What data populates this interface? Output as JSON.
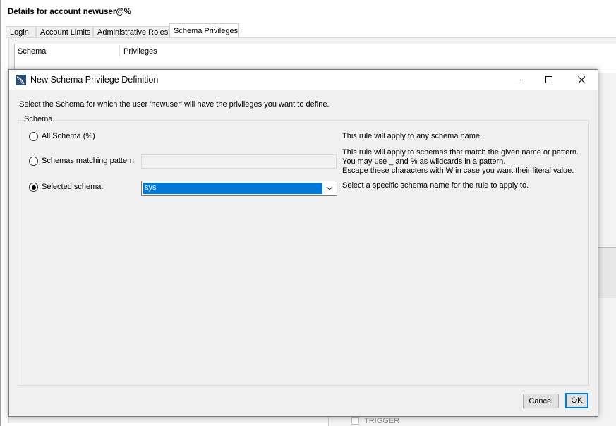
{
  "background": {
    "title": "Details for account newuser@%",
    "tabs": [
      "Login",
      "Account Limits",
      "Administrative Roles",
      "Schema Privileges"
    ],
    "active_tab": "Schema Privileges",
    "table_headers": [
      "Schema",
      "Privileges"
    ],
    "trigger_label": "TRIGGER"
  },
  "dialog": {
    "title": "New Schema Privilege Definition",
    "instruction": "Select the Schema for which the user 'newuser' will have the privileges you want to define.",
    "group_label": "Schema",
    "options": {
      "all": {
        "label": "All Schema (%)",
        "description": "This rule will apply to any schema name.",
        "selected": false
      },
      "pattern": {
        "label": "Schemas matching pattern:",
        "value": "",
        "description_lines": [
          "This rule will apply to schemas that match the given name or pattern.",
          "You may use _ and % as wildcards in a pattern.",
          "Escape these characters with ₩ in case you want their literal value."
        ],
        "selected": false
      },
      "selected": {
        "label": "Selected schema:",
        "value": "sys",
        "description": "Select a specific schema name for the rule to apply to.",
        "selected": true
      }
    },
    "buttons": {
      "cancel": "Cancel",
      "ok": "OK"
    },
    "window_controls": [
      "minimize-icon",
      "maximize-icon",
      "close-icon"
    ]
  },
  "colors": {
    "accent": "#0078d7",
    "dialog_bg": "#f0f0f0",
    "border": "#7a7a7a"
  }
}
